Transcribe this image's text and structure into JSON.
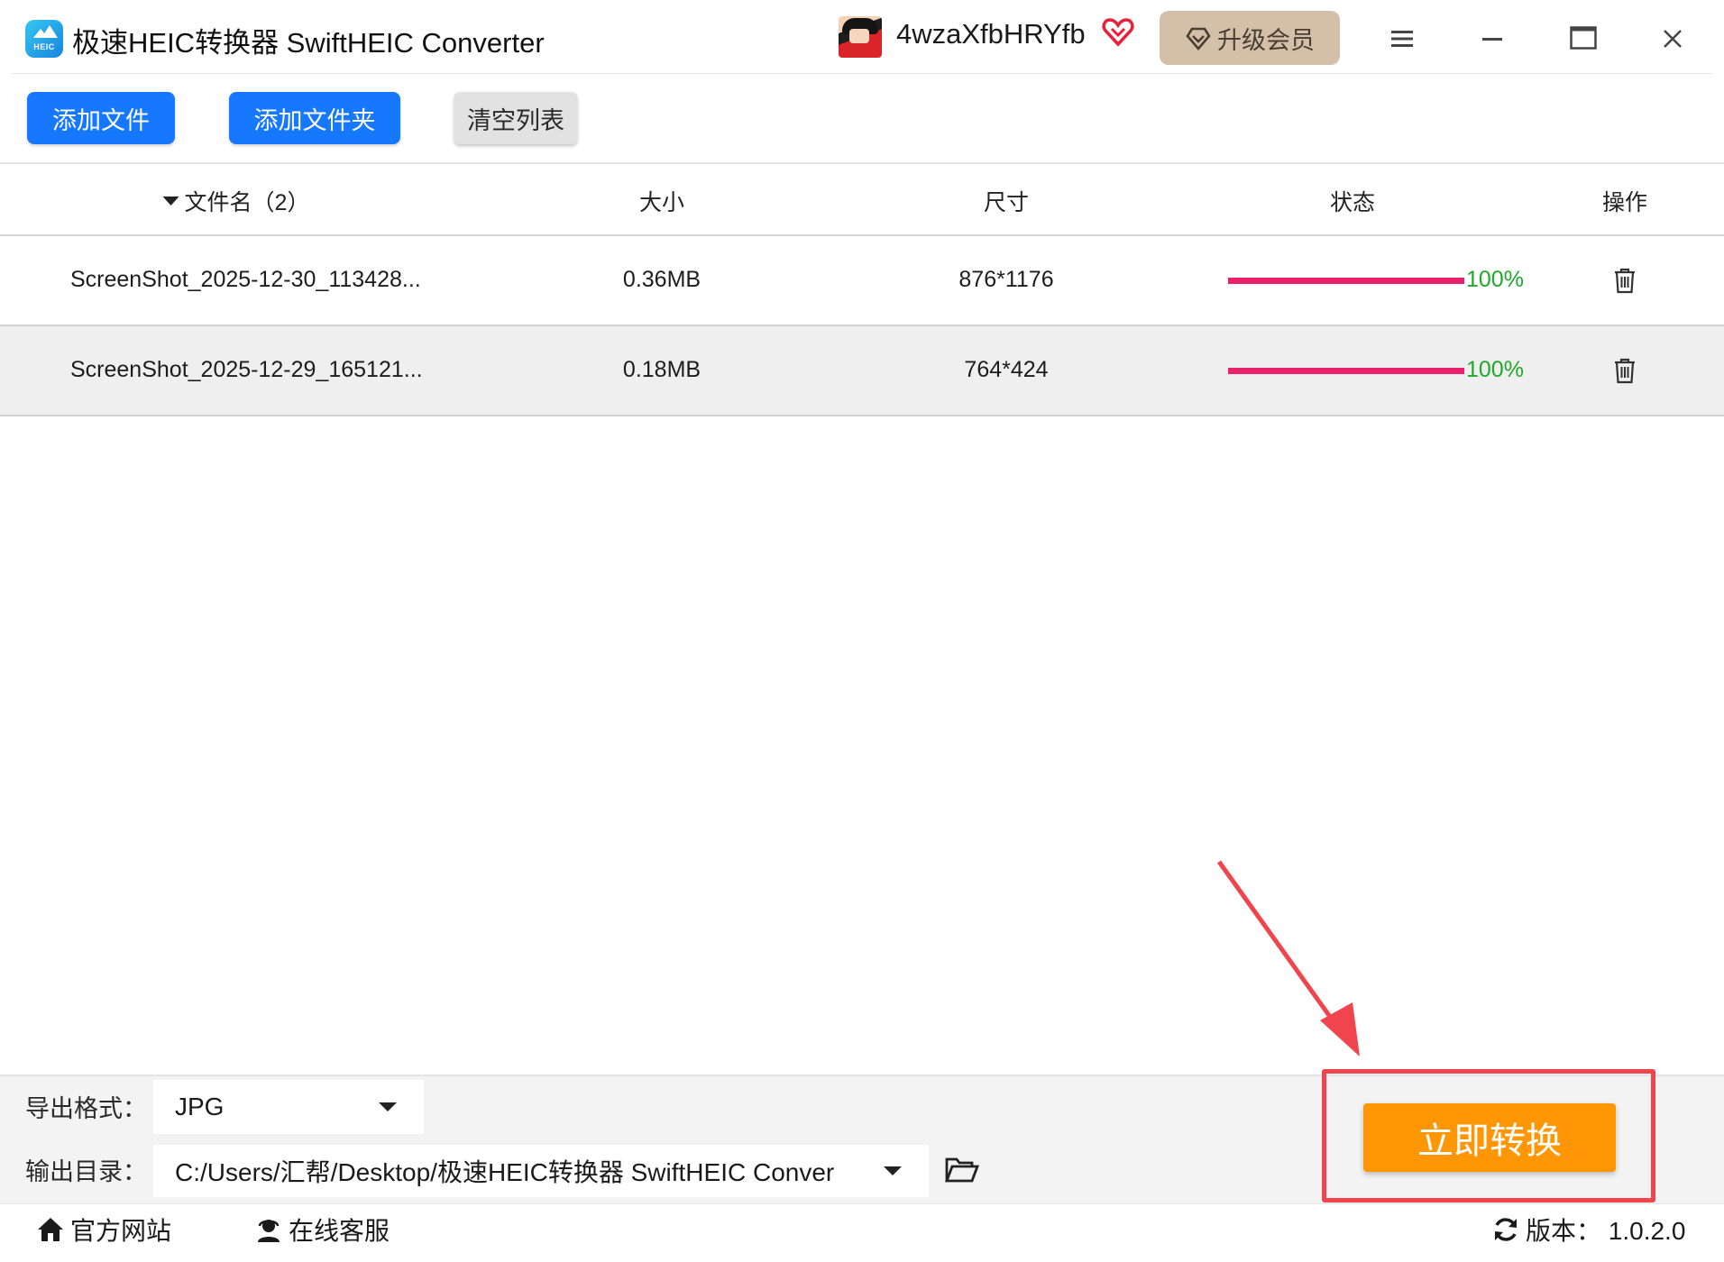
{
  "window": {
    "app_icon_text": "HEIC",
    "title": "极速HEIC转换器 SwiftHEIC Converter",
    "username": "4wzaXfbHRYfb",
    "upgrade_label": "升级会员"
  },
  "toolbar": {
    "add_file": "添加文件",
    "add_folder": "添加文件夹",
    "clear_list": "清空列表"
  },
  "table": {
    "headers": {
      "filename": "文件名（2）",
      "size": "大小",
      "dimensions": "尺寸",
      "status": "状态",
      "actions": "操作"
    },
    "rows": [
      {
        "name": "ScreenShot_2025-12-30_113428...",
        "size": "0.36MB",
        "dimensions": "876*1176",
        "progress": 100,
        "progress_label": "100%"
      },
      {
        "name": "ScreenShot_2025-12-29_165121...",
        "size": "0.18MB",
        "dimensions": "764*424",
        "progress": 100,
        "progress_label": "100%"
      }
    ]
  },
  "bottom": {
    "format_label": "导出格式：",
    "format_value": "JPG",
    "output_label": "输出目录：",
    "output_value": "C:/Users/汇帮/Desktop/极速HEIC转换器 SwiftHEIC Conver",
    "convert_label": "立即转换"
  },
  "footer": {
    "website": "官方网站",
    "service": "在线客服",
    "version": "版本：  1.0.2.0"
  },
  "colors": {
    "primary": "#1677ff",
    "convert": "#ff9605",
    "progress": "#e8216a",
    "progress_text": "#1fa82a",
    "highlight": "#f0454d",
    "upgrade_bg": "#d4c0a9"
  }
}
